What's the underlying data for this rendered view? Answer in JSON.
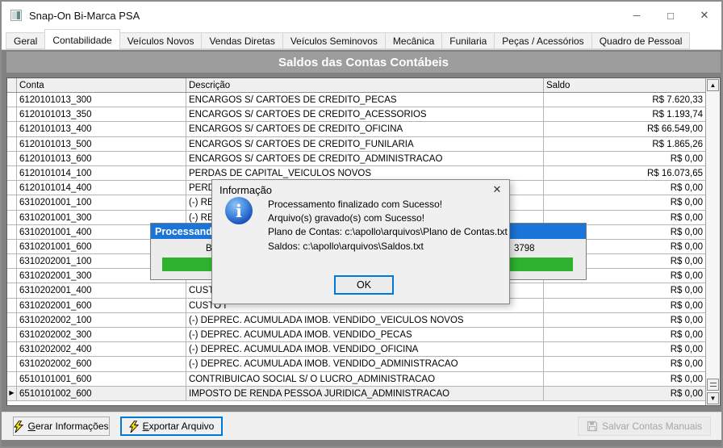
{
  "window": {
    "title": "Snap-On Bi-Marca PSA"
  },
  "icons": {
    "minimize": "─",
    "maximize": "□",
    "close": "✕",
    "dialog_close": "✕",
    "scroll_up": "▲",
    "scroll_down": "▼",
    "current_row": "▶",
    "info_glyph": "i"
  },
  "tabs": [
    {
      "label": "Geral",
      "active": false
    },
    {
      "label": "Contabilidade",
      "active": true
    },
    {
      "label": "Veículos Novos",
      "active": false
    },
    {
      "label": "Vendas Diretas",
      "active": false
    },
    {
      "label": "Veículos Seminovos",
      "active": false
    },
    {
      "label": "Mecânica",
      "active": false
    },
    {
      "label": "Funilaria",
      "active": false
    },
    {
      "label": "Peças / Acessórios",
      "active": false
    },
    {
      "label": "Quadro de Pessoal",
      "active": false
    }
  ],
  "caption": "Saldos das Contas Contábeis",
  "grid": {
    "columns": {
      "conta": "Conta",
      "descricao": "Descrição",
      "saldo": "Saldo"
    },
    "rows": [
      {
        "conta": "6120101013_300",
        "descricao": "ENCARGOS S/ CARTOES DE CREDITO_PECAS",
        "saldo": "R$ 7.620,33",
        "current": false
      },
      {
        "conta": "6120101013_350",
        "descricao": "ENCARGOS S/ CARTOES DE CREDITO_ACESSORIOS",
        "saldo": "R$ 1.193,74",
        "current": false
      },
      {
        "conta": "6120101013_400",
        "descricao": "ENCARGOS S/ CARTOES DE CREDITO_OFICINA",
        "saldo": "R$ 66.549,00",
        "current": false
      },
      {
        "conta": "6120101013_500",
        "descricao": "ENCARGOS S/ CARTOES DE CREDITO_FUNILARIA",
        "saldo": "R$ 1.865,26",
        "current": false
      },
      {
        "conta": "6120101013_600",
        "descricao": "ENCARGOS S/ CARTOES DE CREDITO_ADMINISTRACAO",
        "saldo": "R$ 0,00",
        "current": false
      },
      {
        "conta": "6120101014_100",
        "descricao": "PERDAS DE CAPITAL_VEICULOS NOVOS",
        "saldo": "R$ 16.073,65",
        "current": false
      },
      {
        "conta": "6120101014_400",
        "descricao": "PERDAS",
        "saldo": "R$ 0,00",
        "current": false
      },
      {
        "conta": "6310201001_100",
        "descricao": "(-) RECE",
        "saldo": "R$ 0,00",
        "current": false
      },
      {
        "conta": "6310201001_300",
        "descricao": "(-) RECE",
        "saldo": "R$ 0,00",
        "current": false
      },
      {
        "conta": "6310201001_400",
        "descricao": "",
        "saldo": "R$ 0,00",
        "current": false
      },
      {
        "conta": "6310201001_600",
        "descricao": "",
        "saldo": "R$ 0,00",
        "current": false
      },
      {
        "conta": "6310202001_100",
        "descricao": "",
        "saldo": "R$ 0,00",
        "current": false
      },
      {
        "conta": "6310202001_300",
        "descricao": "",
        "saldo": "R$ 0,00",
        "current": false
      },
      {
        "conta": "6310202001_400",
        "descricao": "CUSTO I",
        "saldo": "R$ 0,00",
        "current": false
      },
      {
        "conta": "6310202001_600",
        "descricao": "CUSTO I",
        "saldo": "R$ 0,00",
        "current": false
      },
      {
        "conta": "6310202002_100",
        "descricao": "(-) DEPREC. ACUMULADA IMOB. VENDIDO_VEICULOS NOVOS",
        "saldo": "R$ 0,00",
        "current": false
      },
      {
        "conta": "6310202002_300",
        "descricao": "(-) DEPREC. ACUMULADA IMOB. VENDIDO_PECAS",
        "saldo": "R$ 0,00",
        "current": false
      },
      {
        "conta": "6310202002_400",
        "descricao": "(-) DEPREC. ACUMULADA IMOB. VENDIDO_OFICINA",
        "saldo": "R$ 0,00",
        "current": false
      },
      {
        "conta": "6310202002_600",
        "descricao": "(-) DEPREC. ACUMULADA IMOB. VENDIDO_ADMINISTRACAO",
        "saldo": "R$ 0,00",
        "current": false
      },
      {
        "conta": "6510101001_600",
        "descricao": "CONTRIBUICAO SOCIAL S/ O LUCRO_ADMINISTRACAO",
        "saldo": "R$ 0,00",
        "current": false
      },
      {
        "conta": "6510101002_600",
        "descricao": "IMPOSTO DE RENDA PESSOA JURIDICA_ADMINISTRACAO",
        "saldo": "R$ 0,00",
        "current": true
      }
    ]
  },
  "progress_dialog": {
    "title": "Processando",
    "left_fragment": "Bi-M",
    "right_fragment": "3798",
    "bar_color": "#2db32d"
  },
  "info_dialog": {
    "title": "Informação",
    "lines": [
      "Processamento finalizado com Sucesso!",
      "Arquivo(s) gravado(s) com Sucesso!",
      "Plano de Contas: c:\\apollo\\arquivos\\Plano de Contas.txt",
      "Saldos: c:\\apollo\\arquivos\\Saldos.txt"
    ],
    "ok_label": "OK"
  },
  "footer": {
    "gerar": {
      "accel": "G",
      "rest": "erar Informações"
    },
    "exportar": {
      "accel": "E",
      "rest": "xportar Arquivo"
    },
    "salvar": "Salvar Contas Manuais"
  },
  "colors": {
    "progress_title_blue": "#1b74d8",
    "progress_green": "#2db32d",
    "focus_blue": "#0078d7",
    "caption_bg": "#9d9d9d",
    "panel_bg": "#818181"
  }
}
